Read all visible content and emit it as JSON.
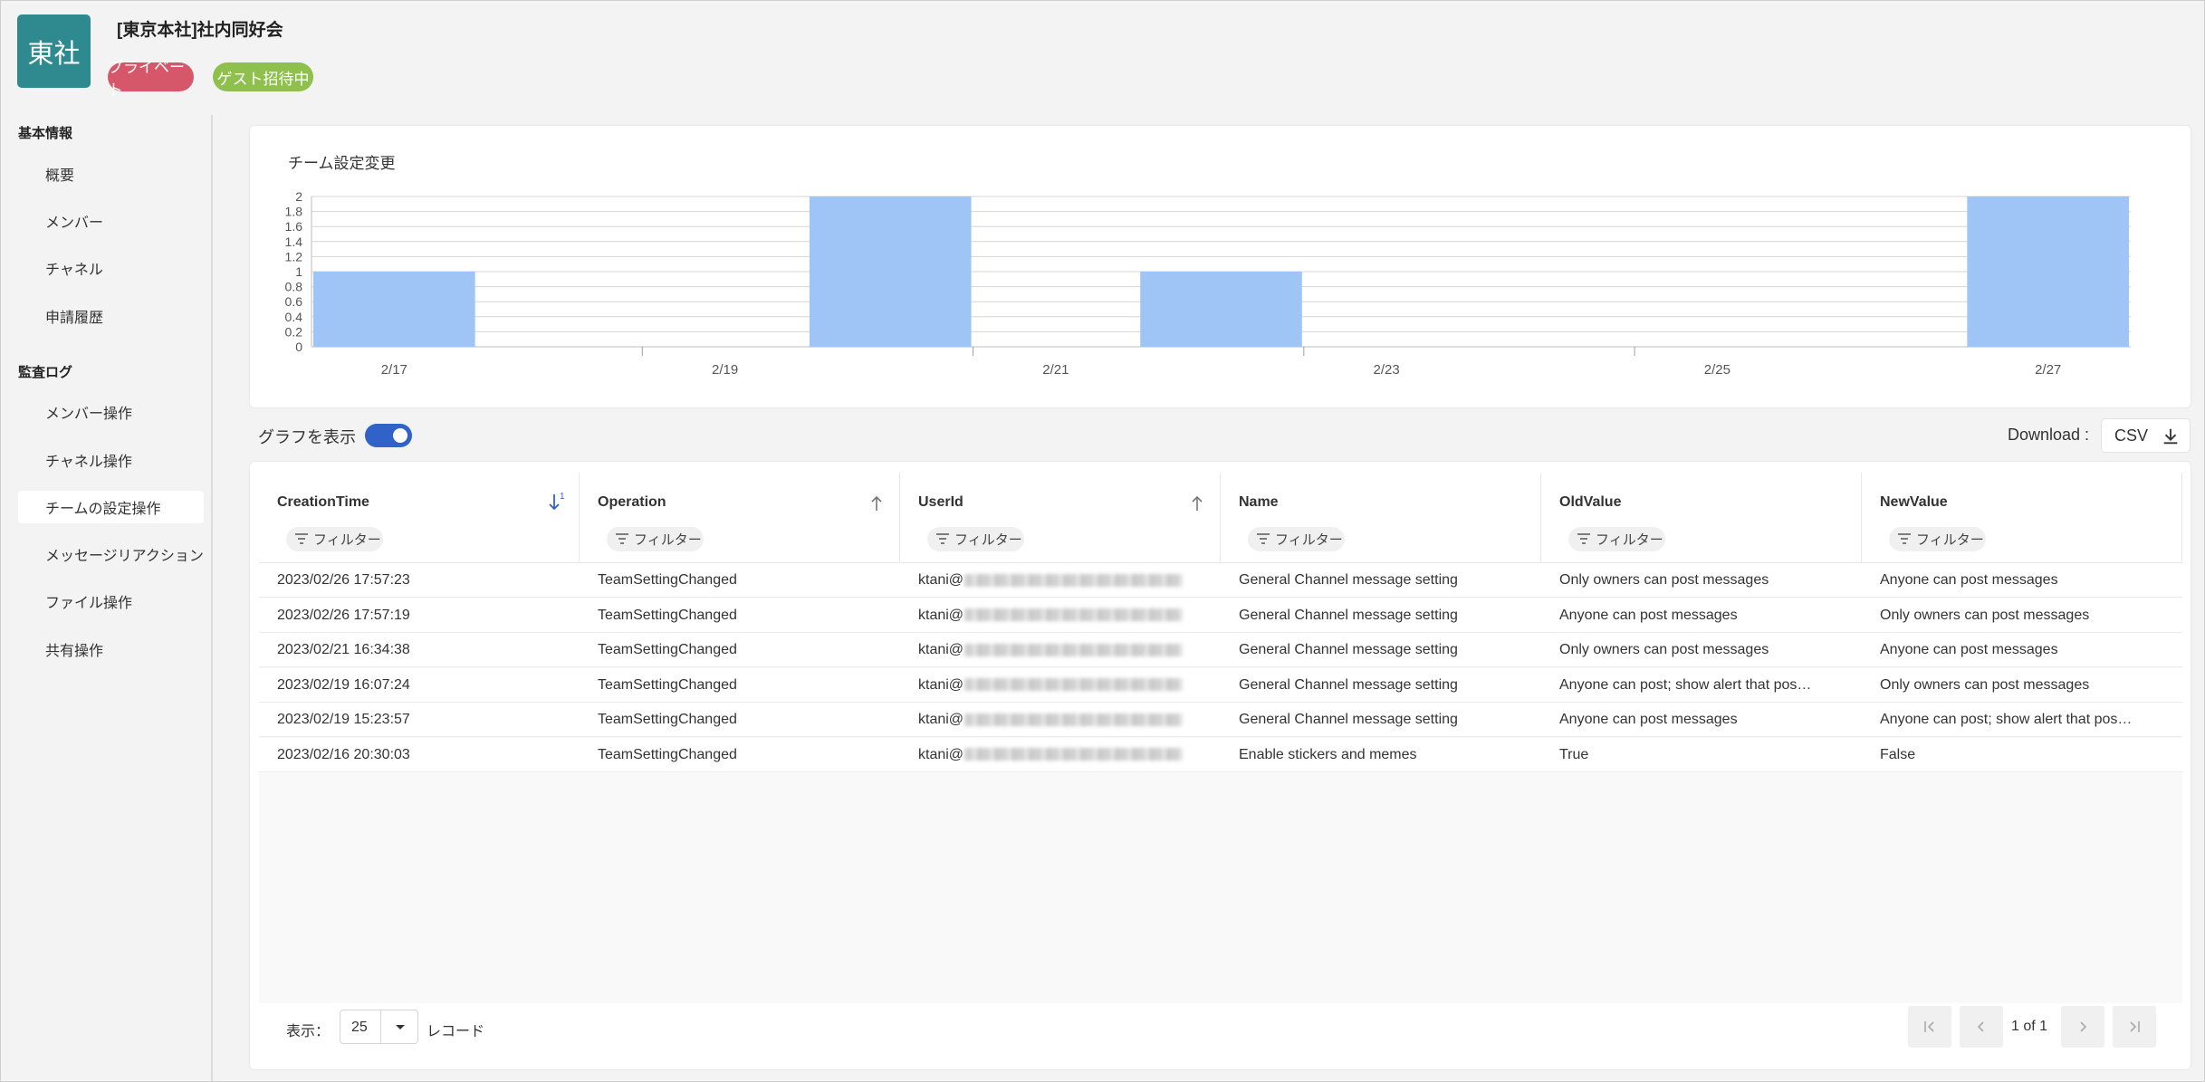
{
  "team": {
    "logo_text": "東社",
    "name": "[東京本社]社内同好会",
    "badges": {
      "private": "プライベート",
      "guest": "ゲスト招待中"
    }
  },
  "sidebar": {
    "sections": [
      {
        "heading": "基本情報",
        "items": [
          "概要",
          "メンバー",
          "チャネル",
          "申請履歴"
        ]
      },
      {
        "heading": "監査ログ",
        "items": [
          "メンバー操作",
          "チャネル操作",
          "チームの設定操作",
          "メッセージリアクション",
          "ファイル操作",
          "共有操作"
        ]
      }
    ],
    "active_item": "チームの設定操作"
  },
  "chart_data": {
    "type": "bar",
    "title": "チーム設定変更",
    "categories": [
      "2/17",
      "2/18",
      "2/19",
      "2/20",
      "2/21",
      "2/22",
      "2/23",
      "2/24",
      "2/25",
      "2/26",
      "2/27"
    ],
    "tick_labels": [
      "2/17",
      "2/19",
      "2/21",
      "2/23",
      "2/25",
      "2/27"
    ],
    "values": [
      1,
      0,
      0,
      2,
      0,
      1,
      0,
      0,
      0,
      0,
      2
    ],
    "y_ticks": [
      "0",
      "0.2",
      "0.4",
      "0.6",
      "0.8",
      "1",
      "1.2",
      "1.4",
      "1.6",
      "1.8",
      "2"
    ],
    "ylim": [
      0,
      2
    ],
    "grid": true,
    "bar_color": "#9ec5f5"
  },
  "toolbar": {
    "toggle_label": "グラフを表示",
    "toggle_on": true,
    "download_label": "Download :",
    "csv_label": "CSV"
  },
  "table": {
    "columns": [
      {
        "title": "CreationTime",
        "sort": "desc",
        "sort_index": "1",
        "filter": "フィルター"
      },
      {
        "title": "Operation",
        "sort": "asc",
        "filter": "フィルター"
      },
      {
        "title": "UserId",
        "sort": "asc",
        "filter": "フィルター"
      },
      {
        "title": "Name",
        "filter": "フィルター"
      },
      {
        "title": "OldValue",
        "filter": "フィルター"
      },
      {
        "title": "NewValue",
        "filter": "フィルター"
      }
    ],
    "rows": [
      {
        "time": "2023/02/26 17:57:23",
        "op": "TeamSettingChanged",
        "user": "ktani@",
        "name": "General Channel message setting",
        "old": "Only owners can post messages",
        "new": "Anyone can post messages"
      },
      {
        "time": "2023/02/26 17:57:19",
        "op": "TeamSettingChanged",
        "user": "ktani@",
        "name": "General Channel message setting",
        "old": "Anyone can post messages",
        "new": "Only owners can post messages"
      },
      {
        "time": "2023/02/21 16:34:38",
        "op": "TeamSettingChanged",
        "user": "ktani@",
        "name": "General Channel message setting",
        "old": "Only owners can post messages",
        "new": "Anyone can post messages"
      },
      {
        "time": "2023/02/19 16:07:24",
        "op": "TeamSettingChanged",
        "user": "ktani@",
        "name": "General Channel message setting",
        "old": "Anyone can post; show alert that pos…",
        "new": "Only owners can post messages"
      },
      {
        "time": "2023/02/19 15:23:57",
        "op": "TeamSettingChanged",
        "user": "ktani@",
        "name": "General Channel message setting",
        "old": "Anyone can post messages",
        "new": "Anyone can post; show alert that pos…"
      },
      {
        "time": "2023/02/16 20:30:03",
        "op": "TeamSettingChanged",
        "user": "ktani@",
        "name": "Enable stickers and memes",
        "old": "True",
        "new": "False"
      }
    ]
  },
  "footer": {
    "show_label": "表示：",
    "page_size": "25",
    "unit_label": "レコード",
    "page_info": "1 of 1"
  }
}
